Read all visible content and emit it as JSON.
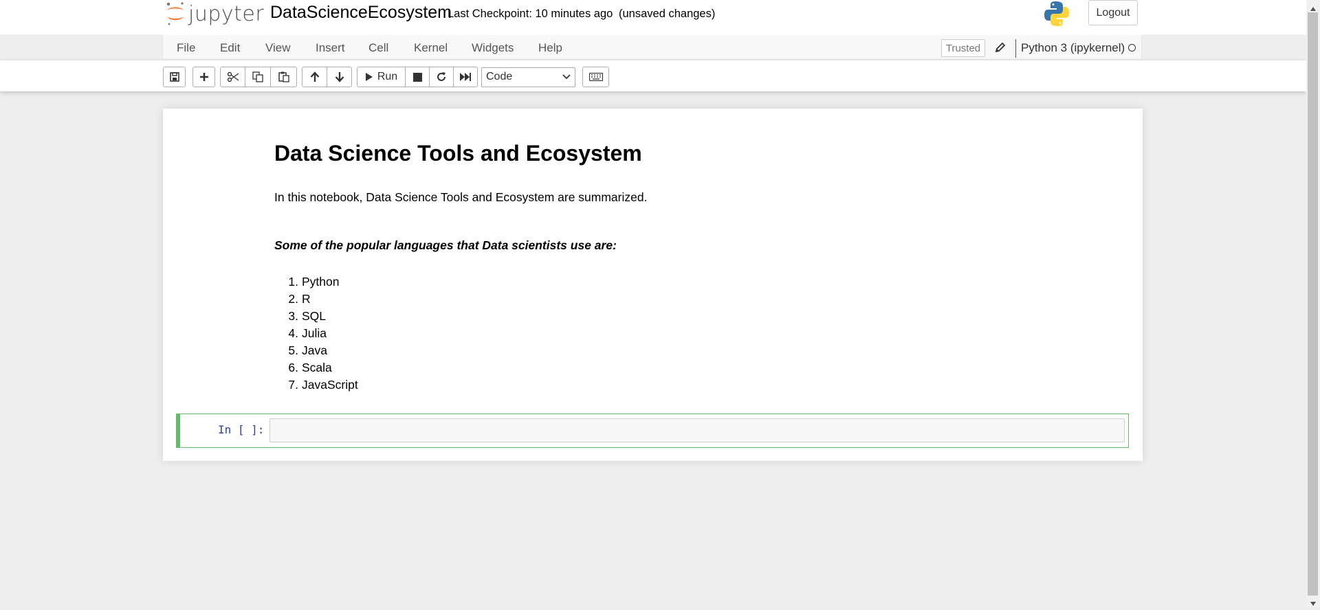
{
  "header": {
    "logo_text": "jupyter",
    "notebook_name": "DataScienceEcosystem",
    "checkpoint": "Last Checkpoint: 10 minutes ago",
    "unsaved": "(unsaved changes)",
    "logout_label": "Logout"
  },
  "menu": {
    "items": [
      "File",
      "Edit",
      "View",
      "Insert",
      "Cell",
      "Kernel",
      "Widgets",
      "Help"
    ],
    "trusted_label": "Trusted",
    "kernel_name": "Python 3 (ipykernel)"
  },
  "toolbar": {
    "run_label": "Run",
    "cell_type": "Code"
  },
  "notebook": {
    "title": "Data Science Tools and Ecosystem",
    "intro": "In this notebook, Data Science Tools and Ecosystem are summarized.",
    "languages_heading": "Some of the popular languages that Data scientists use are:",
    "languages": [
      {
        "num": "1.",
        "name": "Python"
      },
      {
        "num": "2.",
        "name": "R"
      },
      {
        "num": "3.",
        "name": "SQL"
      },
      {
        "num": "4.",
        "name": "Julia"
      },
      {
        "num": "5.",
        "name": "Java"
      },
      {
        "num": "6.",
        "name": "Scala"
      },
      {
        "num": "7.",
        "name": "JavaScript"
      }
    ],
    "code_prompt": "In [ ]:"
  },
  "colors": {
    "accent_orange": "#f37726",
    "cell_selected": "#66bb6a",
    "prompt_blue": "#303f9f"
  }
}
